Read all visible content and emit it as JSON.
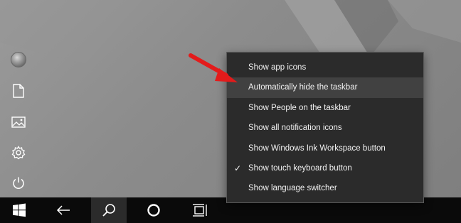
{
  "start_rail": {
    "items": [
      {
        "name": "user-avatar",
        "icon": "avatar"
      },
      {
        "name": "documents",
        "icon": "document-icon"
      },
      {
        "name": "pictures",
        "icon": "picture-icon"
      },
      {
        "name": "settings",
        "icon": "gear-icon"
      },
      {
        "name": "power",
        "icon": "power-icon"
      }
    ]
  },
  "taskbar": {
    "buttons": [
      {
        "name": "start",
        "icon": "windows-logo-icon"
      },
      {
        "name": "back",
        "icon": "back-arrow-icon"
      },
      {
        "name": "search",
        "icon": "search-icon",
        "active": true
      },
      {
        "name": "cortana",
        "icon": "circle-icon"
      },
      {
        "name": "task-view",
        "icon": "task-view-icon"
      }
    ]
  },
  "context_menu": {
    "items": [
      {
        "label": "Show app icons",
        "checked": false
      },
      {
        "label": "Automatically hide the taskbar",
        "checked": false,
        "highlighted": true
      },
      {
        "label": "Show People on the taskbar",
        "checked": false
      },
      {
        "label": "Show all notification icons",
        "checked": false
      },
      {
        "label": "Show Windows Ink Workspace button",
        "checked": false
      },
      {
        "label": "Show touch keyboard button",
        "checked": true
      },
      {
        "label": "Show language switcher",
        "checked": false
      }
    ],
    "check_glyph": "✓"
  },
  "annotation": {
    "icon": "red-arrow-icon",
    "color": "#e31b1b"
  },
  "colors": {
    "menu_bg": "#2b2b2b",
    "menu_hover": "#414141",
    "taskbar_bg": "#0a0a0a",
    "desktop_bg": "#8e8e8e"
  }
}
